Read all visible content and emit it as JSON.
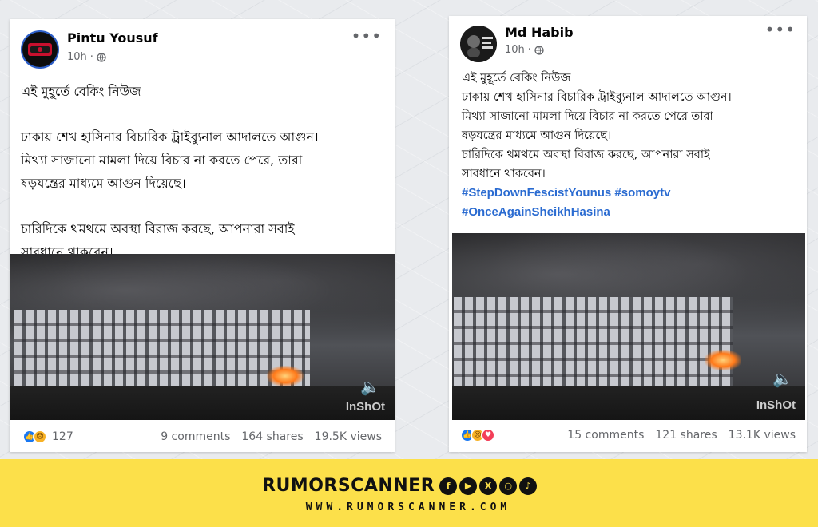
{
  "posts": [
    {
      "author": "Pintu Yousuf",
      "time": "10h",
      "privacy_icon": "globe-icon",
      "lines": [
        "এই মুহূর্তে বেকিং নিউজ",
        "ঢাকায় শেখ হাসিনার বিচারিক ট্রাইব্যুনাল আদালতে আগুন।",
        "মিথ্যা সাজানো মামলা দিয়ে বিচার না করতে পেরে, তারা",
        "ষড়যন্ত্রের মাধ্যমে আগুন দিয়েছে।",
        "চারিদিকে থমথমে অবস্থা বিরাজ করছে, আপনারা সবাই",
        "সাবধানে থাকবেন।"
      ],
      "video_watermark": "InShOt",
      "reaction_icons": [
        "like-icon",
        "sad-icon"
      ],
      "reaction_count": "127",
      "comments": "9 comments",
      "shares": "164 shares",
      "views": "19.5K views"
    },
    {
      "author": "Md Habib",
      "time": "10h",
      "privacy_icon": "globe-icon",
      "lines": [
        "এই মুহূর্তে বেকিং নিউজ",
        "ঢাকায় শেখ হাসিনার বিচারিক ট্রাইব্যুনাল আদালতে আগুন।",
        "মিথ্যা সাজানো মামলা দিয়ে বিচার না করতে পেরে তারা",
        "ষড়যন্ত্রের মাধ্যমে আগুন দিয়েছে।",
        "চারিদিকে থমথমে অবস্থা বিরাজ করছে, আপনারা সবাই",
        "সাবধানে থাকবেন।"
      ],
      "hashtags": [
        "#StepDownFescistYounus #somoytv",
        "#OnceAgainSheikhHasina"
      ],
      "video_watermark": "InShOt",
      "reaction_icons": [
        "like-icon",
        "sad-icon",
        "love-icon"
      ],
      "comments": "15 comments",
      "shares": "121 shares",
      "views": "13.1K views"
    }
  ],
  "banner": {
    "brand": "RUMORSCANNER",
    "url": "WWW.RUMORSCANNER.COM",
    "social_icons": [
      "facebook-icon",
      "youtube-icon",
      "x-icon",
      "instagram-icon",
      "tiktok-icon"
    ]
  },
  "colors": {
    "hashtag": "#2a6bd1",
    "banner_bg": "#fce04a",
    "like": "#1877f2",
    "love": "#f33e58",
    "sad": "#f7b125"
  }
}
